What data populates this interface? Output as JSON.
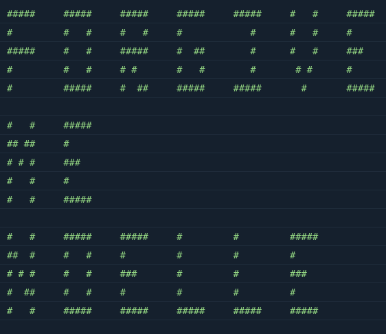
{
  "rows": [
    "#####     #####     #####     #####     #####     #   #     #####",
    "#         #   #     #   #     #            #      #   #     #",
    "#####     #   #     #####     #  ##        #      #   #     ###",
    "#         #   #     # #       #   #        #       # #      #",
    "#         #####     #  ##     #####     #####       #       #####",
    "",
    "#   #     #####",
    "## ##     #",
    "# # #     ###",
    "#   #     #",
    "#   #     #####",
    "",
    "#   #     #####     #####     #         #         #####",
    "##  #     #   #     #         #         #         #",
    "# # #     #   #     ###       #         #         ###",
    "#  ##     #   #     #         #         #         #",
    "#   #     #####     #####     #####     #####     #####"
  ]
}
